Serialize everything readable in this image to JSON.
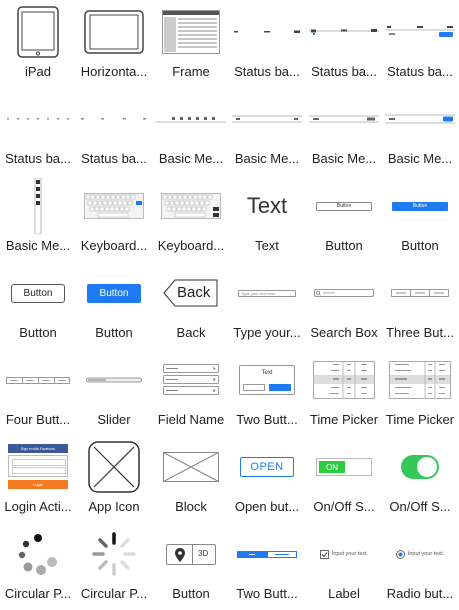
{
  "items": [
    {
      "label": "iPad"
    },
    {
      "label": "Horizonta..."
    },
    {
      "label": "Frame"
    },
    {
      "label": "Status ba..."
    },
    {
      "label": "Status ba..."
    },
    {
      "label": "Status ba..."
    },
    {
      "label": "Status ba..."
    },
    {
      "label": "Status ba..."
    },
    {
      "label": "Basic Me..."
    },
    {
      "label": "Basic Me..."
    },
    {
      "label": "Basic Me..."
    },
    {
      "label": "Basic Me..."
    },
    {
      "label": "Basic Me..."
    },
    {
      "label": "Keyboard..."
    },
    {
      "label": "Keyboard..."
    },
    {
      "label": "Text"
    },
    {
      "label": "Button"
    },
    {
      "label": "Button"
    },
    {
      "label": "Button"
    },
    {
      "label": "Button"
    },
    {
      "label": "Back"
    },
    {
      "label": "Type your..."
    },
    {
      "label": "Search Box"
    },
    {
      "label": "Three But..."
    },
    {
      "label": "Four Butt..."
    },
    {
      "label": "Slider"
    },
    {
      "label": "Field Name"
    },
    {
      "label": "Two Butt..."
    },
    {
      "label": "Time Picker"
    },
    {
      "label": "Time Picker"
    },
    {
      "label": "Login Acti..."
    },
    {
      "label": "App Icon"
    },
    {
      "label": "Block"
    },
    {
      "label": "Open but..."
    },
    {
      "label": "On/Off S..."
    },
    {
      "label": "On/Off S..."
    },
    {
      "label": "Circular P..."
    },
    {
      "label": "Circular P..."
    },
    {
      "label": "Button"
    },
    {
      "label": "Two Butt..."
    },
    {
      "label": "Label"
    },
    {
      "label": "Radio but..."
    }
  ],
  "previews": {
    "text_sample": "Text",
    "button_small": "Button",
    "button_large": "Button",
    "button_large_blue": "Button",
    "back_label": "Back",
    "type_placeholder": "Type your text here",
    "open_label": "OPEN",
    "on_label": "ON",
    "three_d_label": "3D",
    "label_text": "Input your text.",
    "radio_text": "Input your text.",
    "login_header": "Sign in with Facebook",
    "login_button": "Login"
  },
  "colors": {
    "accent": "#1e7bf2",
    "toggle_green": "#34c759",
    "green_dark": "#2ecc40",
    "orange": "#f47b20"
  }
}
